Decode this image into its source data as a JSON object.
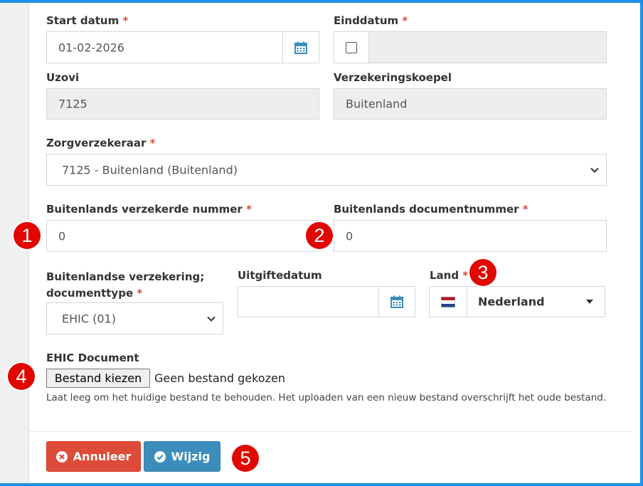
{
  "form": {
    "required_mark": "*",
    "start_date": {
      "label": "Start datum",
      "value": "01-02-2026",
      "icon": "calendar-icon"
    },
    "end_date": {
      "label": "Einddatum",
      "checked": false,
      "value": ""
    },
    "uzovi": {
      "label": "Uzovi",
      "value": "7125"
    },
    "umbrella": {
      "label": "Verzekeringskoepel",
      "value": "Buitenland"
    },
    "insurer": {
      "label": "Zorgverzekeraar",
      "value": "7125 - Buitenland (Buitenland)"
    },
    "foreign_insured_number": {
      "label": "Buitenlands verzekerde nummer",
      "value": "0"
    },
    "foreign_document_number": {
      "label": "Buitenlands documentnummer",
      "value": "0"
    },
    "document_type": {
      "label_line1": "Buitenlandse verzekering;",
      "label_line2": "documenttype",
      "value": "EHIC (01)"
    },
    "issue_date": {
      "label": "Uitgiftedatum",
      "value": "",
      "icon": "calendar-icon"
    },
    "country": {
      "label": "Land",
      "value": "Nederland",
      "flag": "netherlands-flag-icon"
    },
    "ehic_document": {
      "label": "EHIC Document",
      "button": "Bestand kiezen",
      "status": "Geen bestand gekozen",
      "help": "Laat leeg om het huidige bestand te behouden. Het uploaden van een nieuw bestand overschrijft het oude bestand."
    }
  },
  "actions": {
    "cancel_label": "Annuleer",
    "cancel_color": "#dd4b39",
    "save_label": "Wijzig",
    "save_color": "#3c8dbc"
  },
  "annotations": [
    "1",
    "2",
    "3",
    "4",
    "5"
  ],
  "colors": {
    "frame": "#1e90e6",
    "badge": "#e10600",
    "disabled": "#eeeeee",
    "required": "#dd4b39"
  }
}
